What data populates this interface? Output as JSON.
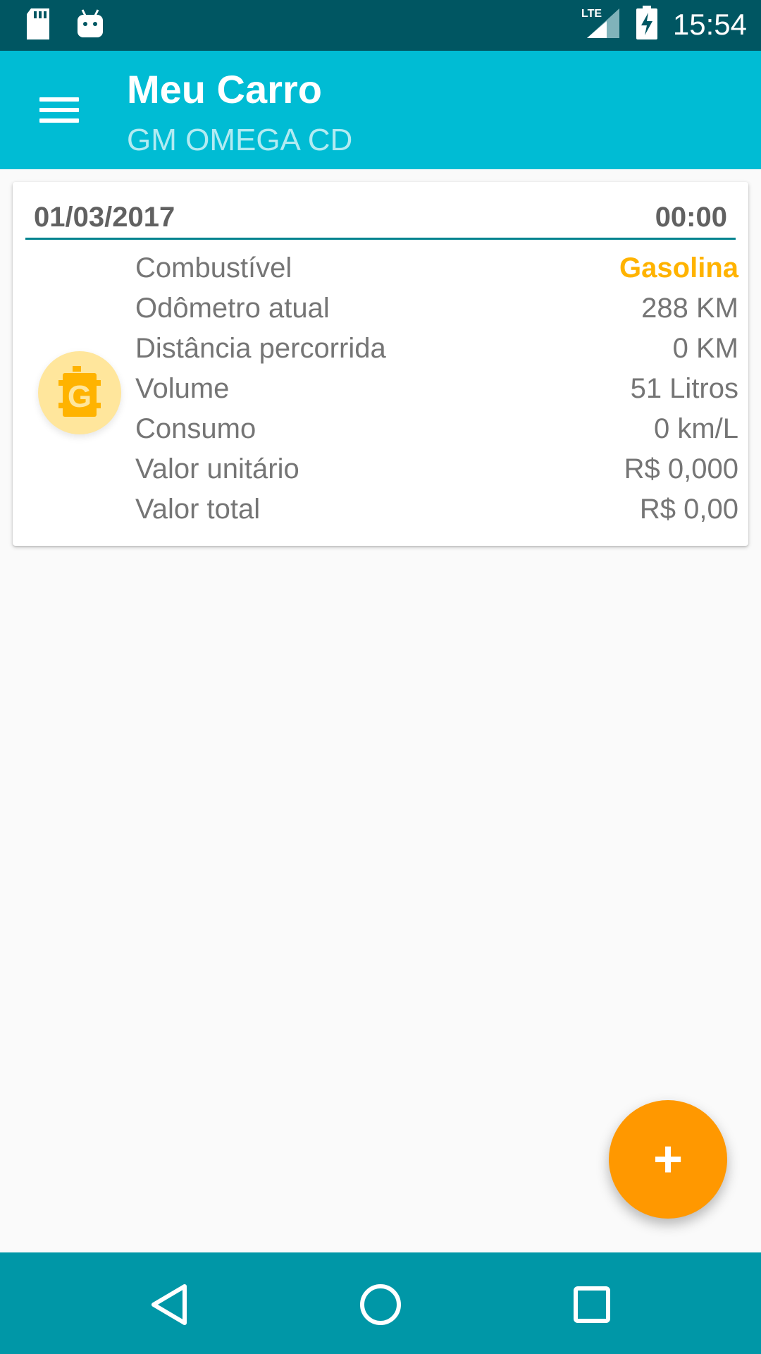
{
  "status_bar": {
    "time": "15:54",
    "network": "LTE",
    "icons": [
      "sd-card-icon",
      "android-icon",
      "lte-signal-icon",
      "battery-charging-icon"
    ]
  },
  "app_bar": {
    "title": "Meu Carro",
    "subtitle": "GM OMEGA CD",
    "menu_icon": "hamburger-menu-icon",
    "color": "#00bcd4"
  },
  "card": {
    "date": "01/03/2017",
    "time": "00:00",
    "badge_letter": "G",
    "badge_icon": "fuel-gasoline-icon",
    "rows": [
      {
        "label": "Combustível",
        "value": "Gasolina"
      },
      {
        "label": "Odômetro atual",
        "value": "288 KM"
      },
      {
        "label": "Distância percorrida",
        "value": "0 KM"
      },
      {
        "label": "Volume",
        "value": "51 Litros"
      },
      {
        "label": "Consumo",
        "value": "0 km/L"
      },
      {
        "label": "Valor unitário",
        "value": "R$ 0,000"
      },
      {
        "label": "Valor total",
        "value": "R$ 0,00"
      }
    ]
  },
  "fab": {
    "label": "+",
    "color": "#ff9800"
  },
  "nav_bar": {
    "icons": [
      "back-icon",
      "home-icon",
      "recents-icon"
    ],
    "color": "#0097a7"
  }
}
